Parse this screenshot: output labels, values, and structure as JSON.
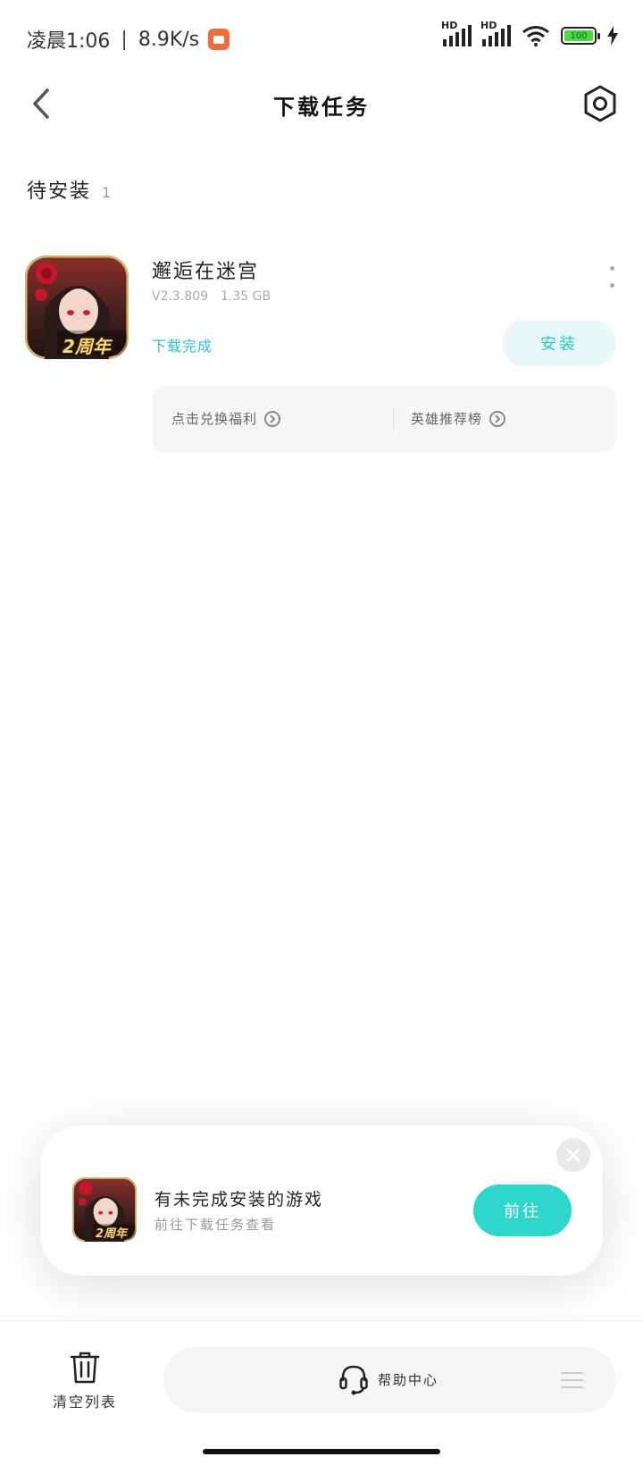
{
  "status_bar": {
    "time": "凌晨1:06",
    "separator": "|",
    "net_speed": "8.9K/s",
    "signal1_label": "HD",
    "signal2_label": "HD",
    "battery_level": "100",
    "colors": {
      "recording": "#f26b3a",
      "battery_fill": "#4cd74a"
    }
  },
  "header": {
    "title": "下载任务",
    "back_icon": "chevron-left-icon",
    "settings_icon": "hexagon-gear-icon"
  },
  "section": {
    "label": "待安装",
    "count": "1"
  },
  "app": {
    "name": "邂逅在迷宫",
    "version": "V2.3.809",
    "size": "1.35 GB",
    "status": "下载完成",
    "install_label": "安装",
    "icon_badge": "2周年",
    "links": [
      {
        "label": "点击兑换福利"
      },
      {
        "label": "英雄推荐榜"
      }
    ]
  },
  "toast": {
    "title": "有未完成安装的游戏",
    "subtitle": "前往下载任务查看",
    "button_label": "前往",
    "icon_badge": "2周年"
  },
  "bottom": {
    "clear_label": "清空列表",
    "help_label": "帮助中心"
  },
  "colors": {
    "accent": "#2cc5c1",
    "button_teal": "#2ed6cc",
    "install_bg": "#e8f8f8"
  }
}
